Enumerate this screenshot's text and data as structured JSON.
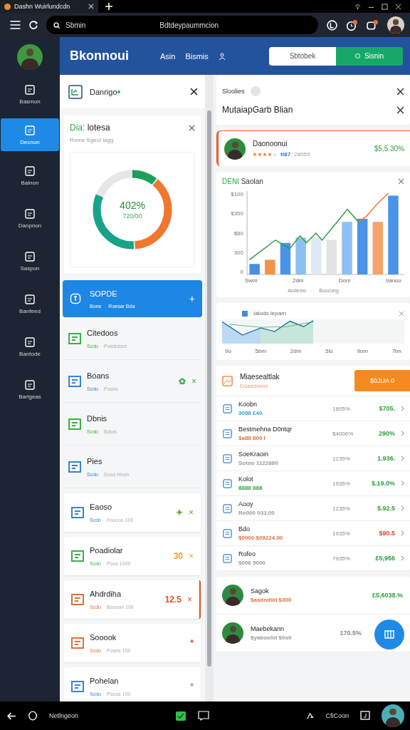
{
  "browser": {
    "tab_title": "Dashn Wuirlundcdn",
    "search_label": "Sbmin",
    "address": "Bdtdeypaummcion"
  },
  "sidebar": {
    "items": [
      {
        "label": "Basmon",
        "selected": false
      },
      {
        "label": "Decnon",
        "selected": true
      },
      {
        "label": "Bainon",
        "selected": false
      },
      {
        "label": "Danpnon",
        "selected": false
      },
      {
        "label": "Saspon",
        "selected": false
      },
      {
        "label": "Banfeed",
        "selected": false
      },
      {
        "label": "Bantode",
        "selected": false
      },
      {
        "label": "Barlgeas",
        "selected": false
      }
    ]
  },
  "header": {
    "brand": "Bkonnoui",
    "nav": [
      "Asin",
      "Bismis"
    ],
    "buttons": [
      {
        "label": "Sbtobek",
        "kind": "outline"
      },
      {
        "label": "Sisnin",
        "kind": "primary"
      }
    ]
  },
  "left_panel": {
    "title": "Danrigo",
    "summary": {
      "tag": "Dia:",
      "title": "lotesa",
      "subtitle": "Rome Sgeoi lagg",
      "center": "402%",
      "center_sub": "720/00"
    },
    "highlight": {
      "title": "SOPDE",
      "tag": "Bone",
      "subtitle": "Roesar Bda",
      "action": "+"
    },
    "items": [
      {
        "kind": "row",
        "title": "Citedoos",
        "tag": "Scdo",
        "subtitle": "Posdcloon",
        "color": "#3fae49"
      },
      {
        "kind": "row",
        "title": "Boans",
        "tag": "Scdo",
        "subtitle": "Poans",
        "color": "#3b82d6",
        "value": {
          "text": "✿",
          "color": "#3fae49"
        },
        "action": "×"
      },
      {
        "kind": "row",
        "title": "Dbnis",
        "tag": "Scdo",
        "subtitle": "Batos",
        "color": "#3fae49"
      },
      {
        "kind": "row",
        "title": "Pies",
        "tag": "Scdo",
        "subtitle": "Sooo Hoon",
        "color": "#3b82d6"
      },
      {
        "kind": "card",
        "title": "Eaoso",
        "tag": "Scdo",
        "subtitle": "Fooooo 100",
        "color": "#3b82d6",
        "value": {
          "text": "✦",
          "color": "#5aa832"
        },
        "action": "×"
      },
      {
        "kind": "card",
        "title": "Poadiolar",
        "tag": "Scdo",
        "subtitle": "Poos 1000",
        "color": "#3fae49",
        "value": {
          "text": "30",
          "color": "#f0a020"
        },
        "action": "×"
      },
      {
        "kind": "card",
        "title": "Ahdrdiha",
        "tag": "Scdo",
        "subtitle": "Boooon 100",
        "color": "#e0703a",
        "value": {
          "text": "12.5",
          "color": "#d9532c"
        },
        "action": "×",
        "selected": true
      },
      {
        "kind": "card",
        "title": "Sooook",
        "tag": "Scdo",
        "subtitle": "Poans   100",
        "color": "#e0703a",
        "value": {
          "text": "*",
          "color": "#d9532c"
        }
      },
      {
        "kind": "card",
        "title": "Pohelan",
        "tag": "Scdo",
        "subtitle": "Pooos 100",
        "color": "#3b82d6",
        "value": {
          "text": "*",
          "color": "#999999"
        }
      }
    ]
  },
  "right_panel": {
    "title": "Sloolies",
    "subtitle": "MutaiapGarb Blian",
    "profile": {
      "name": "Daonoonui",
      "stars": 4,
      "code": "tt87",
      "count": "28059",
      "amount": "$5,5.30%"
    },
    "chart": {
      "tag": "DENI",
      "title": "Saolan",
      "yticks": [
        "$100",
        "$350",
        "$80",
        "300",
        "0"
      ],
      "xticks": [
        "Swm",
        "2dm",
        "Dom",
        "9anoo"
      ],
      "legend": [
        "Aodemo",
        "Boocung"
      ]
    },
    "trend": {
      "legend": "Ialodo ieparn",
      "xticks": [
        "9o",
        "5bm",
        "2dm",
        "5lo",
        "9om",
        "7bn"
      ]
    },
    "table": {
      "title": "Miaesealtlak",
      "subtitle": "Ddasdowst",
      "button": "$0JUA 0",
      "rows": [
        {
          "name": "Koobn",
          "sub": "3098 £40",
          "color": "#2a9fd6",
          "pct": "1805%",
          "value": {
            "text": "$705.",
            "color": "#2e9e3e"
          }
        },
        {
          "name": "Bestmehna D0ntqr",
          "sub": "$a88 800 I",
          "color": "#e0703a",
          "pct": "$4006%",
          "value": {
            "text": "290%",
            "color": "#2e9e3e"
          }
        },
        {
          "name": "SoeKraoin",
          "sub": "Sotoo 1122880",
          "color": "#999999",
          "pct": "1235%",
          "value": {
            "text": "1.936.",
            "color": "#2e9e3e"
          }
        },
        {
          "name": "Kolot",
          "sub": "8888 888",
          "color": "#2e9e3e",
          "pct": "1935%",
          "value": {
            "text": "$.19.0%",
            "color": "#2e9e3e"
          }
        },
        {
          "name": "Aooy",
          "sub": "Ro000 033.00",
          "color": "#999999",
          "pct": "1235%",
          "value": {
            "text": "$.92.5",
            "color": "#2e9e3e"
          }
        },
        {
          "name": "Bdo",
          "sub": "$0000 $09224.00",
          "color": "#e0703a",
          "pct": "1935%",
          "value": {
            "text": "$90.5",
            "color": "#d9432c"
          }
        },
        {
          "name": "Rofeo",
          "sub": "$006 5000",
          "color": "#999999",
          "pct": "7935%",
          "value": {
            "text": "£5,956",
            "color": "#2e9e3e"
          }
        }
      ]
    },
    "people": [
      {
        "name": "Sagok",
        "sub": "$asdnd0d $300",
        "color": "#e0703a",
        "value": {
          "text": "£5,6038.%",
          "color": "#2e9e3e"
        }
      },
      {
        "name": "Maebekann",
        "sub": "$yaboo0d $0s0",
        "color": "#999999",
        "value": {
          "text": "170.5%",
          "color": "#888888"
        }
      }
    ]
  },
  "taskbar": {
    "label": "Netlngeon",
    "right_label": "CfiCoon"
  }
}
